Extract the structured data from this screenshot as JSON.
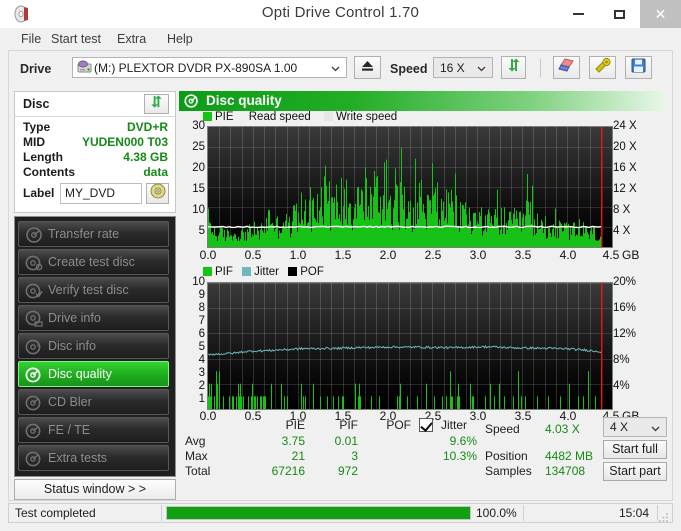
{
  "window": {
    "title": "Opti Drive Control 1.70",
    "icon": "disc-icon",
    "minimize_label": "–",
    "maximize_label": "□",
    "close_label": "×"
  },
  "menubar": {
    "items": [
      {
        "label": "File",
        "name": "menu-file",
        "x": 20
      },
      {
        "label": "Start test",
        "name": "menu-start-test",
        "x": 50
      },
      {
        "label": "Extra",
        "name": "menu-extra",
        "x": 116
      },
      {
        "label": "Help",
        "name": "menu-help",
        "x": 166
      }
    ]
  },
  "toolbar": {
    "drive_label": "Drive",
    "drive_value": "(M:)  PLEXTOR DVDR  PX-890SA 1.00",
    "eject_icon": "eject-icon",
    "speed_label": "Speed",
    "speed_value": "16 X",
    "refresh_icon": "refresh-arrows-icon",
    "erase_icon": "eraser-icon",
    "settings_icon": "tools-icon",
    "save_icon": "floppy-save-icon"
  },
  "disc_panel": {
    "title": "Disc",
    "refresh_icon": "refresh-arrows-icon",
    "rows": [
      {
        "key": "Type",
        "value": "DVD+R"
      },
      {
        "key": "MID",
        "value": "YUDEN000 T03"
      },
      {
        "key": "Length",
        "value": "4.38 GB"
      },
      {
        "key": "Contents",
        "value": "data"
      }
    ],
    "label_key": "Label",
    "label_value": "MY_DVD",
    "label_placeholder": "",
    "label_icon": "cd-disc-icon"
  },
  "sidebar": {
    "items": [
      {
        "label": "Transfer rate",
        "icon": "disc-speed-icon",
        "active": false
      },
      {
        "label": "Create test disc",
        "icon": "disc-burn-icon",
        "active": false
      },
      {
        "label": "Verify test disc",
        "icon": "disc-check-icon",
        "active": false
      },
      {
        "label": "Drive info",
        "icon": "disc-drive-icon",
        "active": false
      },
      {
        "label": "Disc info",
        "icon": "disc-info-icon",
        "active": false
      },
      {
        "label": "Disc quality",
        "icon": "disc-quality-icon",
        "active": true
      },
      {
        "label": "CD Bler",
        "icon": "disc-bler-icon",
        "active": false
      },
      {
        "label": "FE / TE",
        "icon": "disc-fete-icon",
        "active": false
      },
      {
        "label": "Extra tests",
        "icon": "disc-extra-icon",
        "active": false
      }
    ],
    "status_window_label": "Status window > >"
  },
  "content": {
    "header_title": "Disc quality",
    "header_icon": "disc-quality-icon"
  },
  "chart_data": [
    {
      "type": "area",
      "name": "pie-chart",
      "title": "",
      "legend": [
        {
          "label": "PIE",
          "color": "#15c215",
          "swatch": true
        },
        {
          "label": "Read speed",
          "color": "#ffffff",
          "swatch": false
        },
        {
          "label": "Write speed",
          "color": "#e6e6e6",
          "swatch": true
        }
      ],
      "xlabel": "GB",
      "ylabel": "",
      "xlim": [
        0,
        4.5
      ],
      "ylim": [
        0,
        30
      ],
      "yticks": [
        0,
        5,
        10,
        15,
        20,
        25,
        30
      ],
      "xticks": [
        "0.0",
        "0.5",
        "1.0",
        "1.5",
        "2.0",
        "2.5",
        "3.0",
        "3.5",
        "4.0",
        "4.5"
      ],
      "y2lim": [
        0,
        24
      ],
      "y2ticks": [
        "4 X",
        "8 X",
        "12 X",
        "16 X",
        "20 X",
        "24 X"
      ],
      "grid": true,
      "read_speed_line_value": 4.03,
      "end_marker_gb": 4.38,
      "series": [
        {
          "name": "PIE",
          "color": "#15c215",
          "x": [
            0.0,
            0.05,
            0.1,
            0.15,
            0.2,
            0.25,
            0.3,
            0.35,
            0.4,
            0.45,
            0.5,
            0.55,
            0.6,
            0.65,
            0.7,
            0.75,
            0.8,
            0.85,
            0.9,
            0.95,
            1.0,
            1.05,
            1.1,
            1.15,
            1.2,
            1.25,
            1.3,
            1.35,
            1.4,
            1.45,
            1.5,
            1.55,
            1.6,
            1.65,
            1.7,
            1.75,
            1.8,
            1.85,
            1.9,
            1.95,
            2.0,
            2.05,
            2.1,
            2.15,
            2.2,
            2.25,
            2.3,
            2.35,
            2.4,
            2.45,
            2.5,
            2.55,
            2.6,
            2.65,
            2.7,
            2.75,
            2.8,
            2.85,
            2.9,
            2.95,
            3.0,
            3.05,
            3.1,
            3.15,
            3.2,
            3.25,
            3.3,
            3.35,
            3.4,
            3.45,
            3.5,
            3.55,
            3.6,
            3.65,
            3.7,
            3.75,
            3.8,
            3.85,
            3.9,
            3.95,
            4.0,
            4.05,
            4.1,
            4.15,
            4.2,
            4.25,
            4.3,
            4.35,
            4.38
          ],
          "values": [
            9,
            6,
            4,
            5,
            4,
            5,
            4,
            4,
            5,
            5,
            6,
            5,
            6,
            9,
            11,
            7,
            8,
            9,
            7,
            10,
            13,
            12,
            14,
            13,
            12,
            17,
            21,
            15,
            14,
            16,
            17,
            16,
            14,
            19,
            15,
            17,
            16,
            19,
            17,
            15,
            18,
            16,
            14,
            16,
            13,
            14,
            13,
            18,
            15,
            13,
            14,
            16,
            12,
            13,
            14,
            12,
            11,
            13,
            10,
            9,
            10,
            11,
            9,
            8,
            9,
            10,
            9,
            8,
            9,
            8,
            9,
            13,
            10,
            8,
            7,
            8,
            7,
            7,
            6,
            6,
            6,
            6,
            5,
            5,
            5,
            5,
            5,
            4,
            3
          ]
        }
      ]
    },
    {
      "type": "area",
      "name": "pif-jitter-pof-chart",
      "title": "",
      "legend": [
        {
          "label": "PIF",
          "color": "#15c215",
          "swatch": true
        },
        {
          "label": "Jitter",
          "color": "#6fb6bd",
          "swatch": true
        },
        {
          "label": "POF",
          "color": "#000000",
          "swatch": true
        }
      ],
      "xlabel": "GB",
      "ylabel": "",
      "xlim": [
        0,
        4.5
      ],
      "ylim": [
        0,
        10
      ],
      "yticks": [
        1,
        2,
        3,
        4,
        5,
        6,
        7,
        8,
        9,
        10
      ],
      "xticks": [
        "0.0",
        "0.5",
        "1.0",
        "1.5",
        "2.0",
        "2.5",
        "3.0",
        "3.5",
        "4.0",
        "4.5"
      ],
      "y2lim": [
        0,
        20
      ],
      "y2ticks": [
        "4%",
        "8%",
        "12%",
        "16%",
        "20%"
      ],
      "grid": true,
      "end_marker_gb": 4.38,
      "series": [
        {
          "name": "Jitter",
          "color": "#6fb6bd",
          "x": [
            0.0,
            0.1,
            0.2,
            0.3,
            0.4,
            0.5,
            0.6,
            0.7,
            0.8,
            0.9,
            1.0,
            1.1,
            1.2,
            1.3,
            1.4,
            1.5,
            1.6,
            1.7,
            1.8,
            1.9,
            2.0,
            2.1,
            2.2,
            2.3,
            2.4,
            2.5,
            2.6,
            2.7,
            2.8,
            2.9,
            3.0,
            3.1,
            3.2,
            3.3,
            3.4,
            3.5,
            3.6,
            3.7,
            3.8,
            3.9,
            4.0,
            4.1,
            4.2,
            4.3,
            4.38
          ],
          "values": [
            4.35,
            4.35,
            4.4,
            4.45,
            4.55,
            4.6,
            4.62,
            4.65,
            4.7,
            4.72,
            4.78,
            4.8,
            4.78,
            4.82,
            4.8,
            4.84,
            4.86,
            4.88,
            4.88,
            4.9,
            4.92,
            4.92,
            4.9,
            4.92,
            4.9,
            4.88,
            4.88,
            4.86,
            4.88,
            4.9,
            4.92,
            4.94,
            4.92,
            4.88,
            4.86,
            4.84,
            4.84,
            4.82,
            4.82,
            4.8,
            4.78,
            4.72,
            4.68,
            4.6,
            4.55
          ]
        },
        {
          "name": "PIF",
          "color": "#15c215",
          "note": "sparse vertical spikes 1-3 across disc",
          "max": 3
        }
      ]
    }
  ],
  "stats": {
    "columns": [
      "PIE",
      "PIF",
      "POF",
      "Jitter"
    ],
    "jitter_checked": true,
    "rows": [
      {
        "label": "Avg",
        "pie": "3.75",
        "pif": "0.01",
        "pof": "",
        "jitter": "9.6%"
      },
      {
        "label": "Max",
        "pie": "21",
        "pif": "3",
        "pof": "",
        "jitter": "10.3%"
      },
      {
        "label": "Total",
        "pie": "67216",
        "pif": "972",
        "pof": "",
        "jitter": ""
      }
    ],
    "right": [
      {
        "label": "Speed",
        "value": "4.03 X"
      },
      {
        "label": "Position",
        "value": "4482 MB"
      },
      {
        "label": "Samples",
        "value": "134708"
      }
    ],
    "speed_select": "4 X",
    "start_full_label": "Start full",
    "start_part_label": "Start part"
  },
  "statusbar": {
    "message": "Test completed",
    "progress_percent": "100.0%",
    "progress_value": 100,
    "elapsed": "15:04",
    "grip_icon": "resize-grip-icon"
  }
}
